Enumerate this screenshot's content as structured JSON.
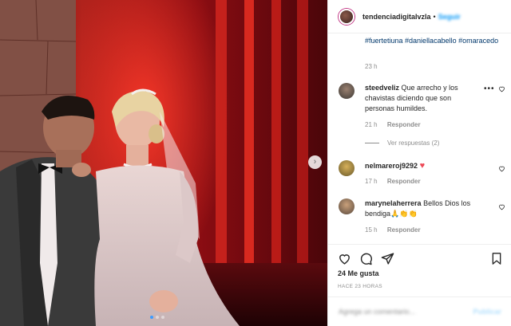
{
  "header": {
    "username": "tendenciadigitalvzla",
    "separator": "•",
    "follow_label": "Seguir"
  },
  "caption": {
    "hashtags": "#fuertetiuna #daniellacabello #omaracedo",
    "time": "23 h"
  },
  "comments": [
    {
      "username": "steedveliz",
      "text": "Que arrecho y los chavistas diciendo que son personas humildes.",
      "time": "21 h",
      "reply_label": "Responder",
      "view_replies": "Ver respuestas (2)",
      "more_label": "•••"
    },
    {
      "username": "nelmareroj9292",
      "text": "♥",
      "time": "17 h",
      "reply_label": "Responder"
    },
    {
      "username": "marynelaherrera",
      "text": "Bellos Dios los bendiga🙏👏👏",
      "time": "15 h",
      "reply_label": "Responder"
    }
  ],
  "actions": {
    "likes": "24 Me gusta",
    "post_time": "HACE 23 HORAS"
  },
  "comment_box": {
    "placeholder": "Agrega un comentario...",
    "publish_label": "Publicar"
  },
  "icons": {
    "next": "chevron-right-icon",
    "like": "heart-icon",
    "comment": "comment-icon",
    "share": "paper-plane-icon",
    "save": "bookmark-icon"
  },
  "colors": {
    "link_blue": "#00376b",
    "follow_blue": "#0095f6",
    "heart_red": "#ed4956",
    "muted_gray": "#8e8e8e",
    "carousel_active": "#3d9bff"
  },
  "carousel": {
    "total": 3,
    "active": 1
  }
}
